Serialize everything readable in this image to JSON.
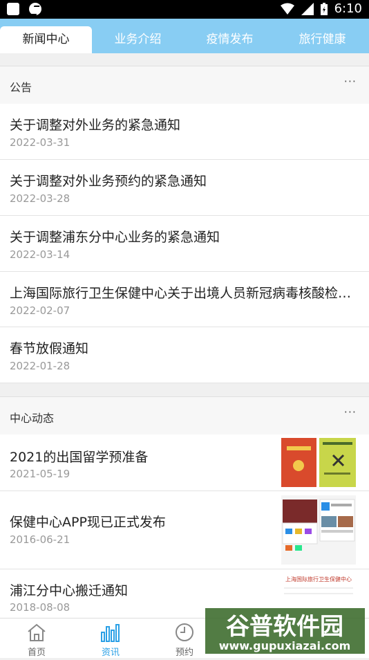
{
  "statusbar": {
    "time": "6:10",
    "battery_icon": "battery-charging-icon",
    "wifi_icon": "wifi-icon",
    "signal_icon": "signal-icon"
  },
  "tabs": [
    {
      "label": "新闻中心",
      "active": true
    },
    {
      "label": "业务介绍",
      "active": false
    },
    {
      "label": "疫情发布",
      "active": false
    },
    {
      "label": "旅行健康",
      "active": false
    }
  ],
  "announcements": {
    "title": "公告",
    "more": "···",
    "items": [
      {
        "title": "关于调整对外业务的紧急通知",
        "date": "2022-03-31"
      },
      {
        "title": "关于调整对外业务预约的紧急通知",
        "date": "2022-03-28"
      },
      {
        "title": "关于调整浦东分中心业务的紧急通知",
        "date": "2022-03-14"
      },
      {
        "title": "上海国际旅行卫生保健中心关于出境人员新冠病毒核酸检测…",
        "date": "2022-02-07"
      },
      {
        "title": "春节放假通知",
        "date": "2022-01-28"
      }
    ]
  },
  "news": {
    "title": "中心动态",
    "more": "···",
    "items": [
      {
        "title": "2021的出国留学预准备",
        "date": "2021-05-19"
      },
      {
        "title": "保健中心APP现已正式发布",
        "date": "2016-06-21"
      },
      {
        "title": "浦江分中心搬迁通知",
        "date": "2018-08-08",
        "thumb_text": "上海国际旅行卫生保健中心"
      }
    ]
  },
  "navbar": [
    {
      "label": "首页",
      "icon": "home-icon",
      "active": false
    },
    {
      "label": "资讯",
      "icon": "bar-chart-icon",
      "active": true
    },
    {
      "label": "预约",
      "icon": "clock-icon",
      "active": false
    }
  ],
  "watermark": {
    "text": "谷普软件园",
    "url": "www.gupuxiazai.com"
  },
  "colors": {
    "tab_bar": "#88cdf3",
    "accent": "#2aa0e6"
  }
}
